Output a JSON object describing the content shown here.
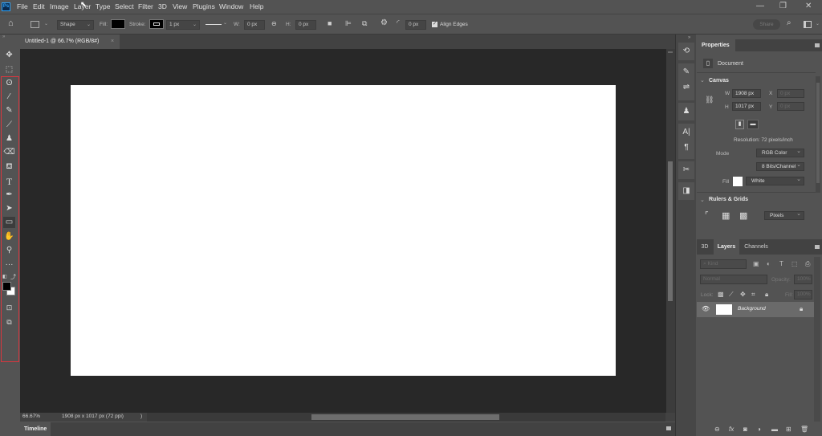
{
  "app": {
    "logo": "Ps"
  },
  "menu": [
    "File",
    "Edit",
    "Image",
    "Layer",
    "Type",
    "Select",
    "Filter",
    "3D",
    "View",
    "Plugins",
    "Window",
    "Help"
  ],
  "window_controls": {
    "minimize": "—",
    "restore": "❐",
    "close": "✕"
  },
  "options_bar": {
    "tool_mode": "Shape",
    "fill_label": "Fill:",
    "fill_color": "#000000",
    "stroke_label": "Stroke:",
    "stroke_width": "1 px",
    "w_label": "W:",
    "w_value": "0 px",
    "h_label": "H:",
    "h_value": "0 px",
    "corner_radius": "0 px",
    "align_edges_label": "Align Edges",
    "align_edges_checked": true,
    "share_label": "Share"
  },
  "document_tab": {
    "title": "Untitled-1 @ 66.7% (RGB/8#)",
    "close": "×"
  },
  "toolbar": {
    "tools": [
      "move",
      "rectangular-marquee",
      "lasso",
      "magic-wand",
      "eyedropper",
      "brush",
      "clone-stamp",
      "eraser",
      "paint-bucket",
      "type",
      "pen",
      "path-selection",
      "rectangle",
      "hand",
      "zoom",
      "edit-toolbar"
    ],
    "foreground_color": "#000000",
    "background_color": "#ffffff"
  },
  "status_bar": {
    "zoom": "66.67%",
    "doc_info": "1908 px x 1017 px (72 ppi)",
    "arrow": ")"
  },
  "timeline": {
    "label": "Timeline"
  },
  "properties": {
    "tab": "Properties",
    "doc_label": "Document",
    "canvas": {
      "title": "Canvas",
      "w_label": "W",
      "w_value": "1908 px",
      "h_label": "H",
      "h_value": "1017 px",
      "x_label": "X",
      "x_value": "0 px",
      "y_label": "Y",
      "y_value": "0 px",
      "resolution": "Resolution: 72 pixels/inch",
      "mode_label": "Mode",
      "mode_value": "RGB Color",
      "bits_value": "8 Bits/Channel",
      "fill_label": "Fill",
      "fill_value": "White",
      "fill_color": "#ffffff"
    },
    "rulers": {
      "title": "Rulers & Grids",
      "units": "Pixels"
    }
  },
  "layers": {
    "tabs": [
      "3D",
      "Layers",
      "Channels"
    ],
    "active_tab": "Layers",
    "filter_placeholder": "Kind",
    "blend_mode": "Normal",
    "opacity_label": "Opacity:",
    "opacity_value": "100%",
    "lock_label": "Lock:",
    "fill_label": "Fill:",
    "fill_value": "100%",
    "items": [
      {
        "name": "Background",
        "visible": true,
        "locked": true
      }
    ]
  }
}
